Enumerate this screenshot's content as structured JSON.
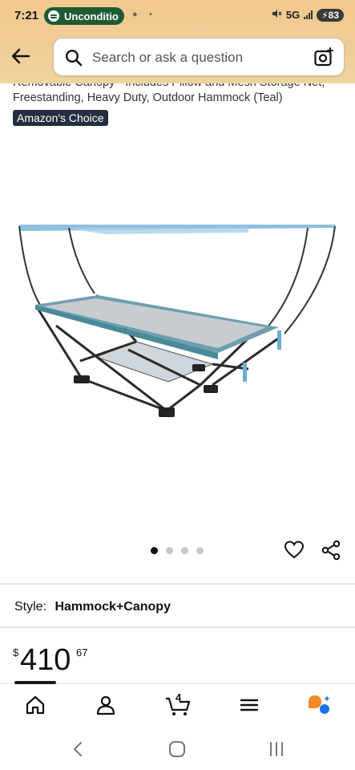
{
  "status_bar": {
    "time": "7:21",
    "media_label": "Unconditio",
    "network": "5G",
    "battery": "83"
  },
  "search": {
    "placeholder": "Search or ask a question"
  },
  "product": {
    "title_line1": "Removable Canopy - Includes Pillow and Mesh Storage Net,",
    "title_line2": "Freestanding, Heavy Duty, Outdoor Hammock (Teal)",
    "badge": "Amazon's Choice",
    "image_count": 4,
    "active_image": 1,
    "style_label": "Style:",
    "style_value": "Hammock+Canopy",
    "price_symbol": "$",
    "price_whole": "410",
    "price_fraction": "67"
  },
  "bottom_nav": {
    "cart_count": "4",
    "items": [
      "home-icon",
      "account-icon",
      "cart-icon",
      "menu-icon",
      "rufus-assistant-icon"
    ]
  },
  "colors": {
    "header": "#f0cd96",
    "badge": "#232f3e",
    "hammock_teal": "#4a8a98",
    "canopy": "#7fb5d6"
  }
}
